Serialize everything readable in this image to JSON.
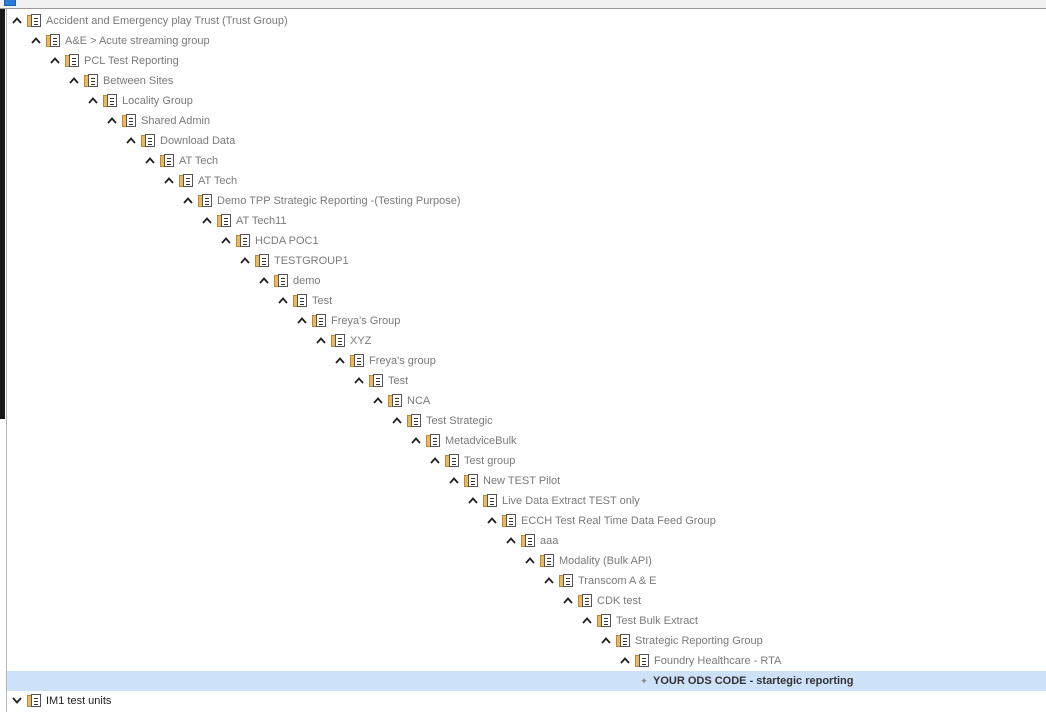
{
  "window": {
    "title": ""
  },
  "tree": {
    "nodes": [
      {
        "label": "Accident and Emergency play Trust (Trust Group)",
        "depth": 0,
        "expanded": true
      },
      {
        "label": "A&E > Acute streaming group",
        "depth": 1,
        "expanded": true
      },
      {
        "label": "PCL Test Reporting",
        "depth": 2,
        "expanded": true
      },
      {
        "label": "Between Sites",
        "depth": 3,
        "expanded": true
      },
      {
        "label": "Locality Group",
        "depth": 4,
        "expanded": true
      },
      {
        "label": "Shared Admin",
        "depth": 5,
        "expanded": true
      },
      {
        "label": "Download Data",
        "depth": 6,
        "expanded": true
      },
      {
        "label": "AT Tech",
        "depth": 7,
        "expanded": true
      },
      {
        "label": "AT Tech",
        "depth": 8,
        "expanded": true
      },
      {
        "label": "Demo TPP Strategic Reporting -(Testing Purpose)",
        "depth": 9,
        "expanded": true
      },
      {
        "label": "AT Tech11",
        "depth": 10,
        "expanded": true
      },
      {
        "label": "HCDA POC1",
        "depth": 11,
        "expanded": true
      },
      {
        "label": "TESTGROUP1",
        "depth": 12,
        "expanded": true
      },
      {
        "label": "demo",
        "depth": 13,
        "expanded": true
      },
      {
        "label": "Test",
        "depth": 14,
        "expanded": true
      },
      {
        "label": "Freya's Group",
        "depth": 15,
        "expanded": true
      },
      {
        "label": "XYZ",
        "depth": 16,
        "expanded": true
      },
      {
        "label": "Freya's group",
        "depth": 17,
        "expanded": true
      },
      {
        "label": "Test",
        "depth": 18,
        "expanded": true
      },
      {
        "label": "NCA",
        "depth": 19,
        "expanded": true
      },
      {
        "label": "Test Strategic",
        "depth": 20,
        "expanded": true
      },
      {
        "label": "MetadviceBulk",
        "depth": 21,
        "expanded": true
      },
      {
        "label": "Test group",
        "depth": 22,
        "expanded": true
      },
      {
        "label": "New TEST Pilot",
        "depth": 23,
        "expanded": true
      },
      {
        "label": "Live Data Extract TEST only",
        "depth": 24,
        "expanded": true
      },
      {
        "label": "ECCH Test Real Time Data Feed Group",
        "depth": 25,
        "expanded": true
      },
      {
        "label": "aaa",
        "depth": 26,
        "expanded": true
      },
      {
        "label": "Modality (Bulk API)",
        "depth": 27,
        "expanded": true
      },
      {
        "label": "Transcom A & E",
        "depth": 28,
        "expanded": true
      },
      {
        "label": "CDK test",
        "depth": 29,
        "expanded": true
      },
      {
        "label": "Test Bulk Extract",
        "depth": 30,
        "expanded": true
      },
      {
        "label": "Strategic Reporting Group",
        "depth": 31,
        "expanded": true
      },
      {
        "label": "Foundry Healthcare - RTA",
        "depth": 32,
        "expanded": true
      }
    ],
    "selected_leaf": {
      "label": "YOUR ODS CODE - startegic reporting",
      "depth": 33
    },
    "collapsed_root": {
      "label": "IM1 test units",
      "depth": 0,
      "expanded": false
    }
  },
  "colors": {
    "selection": "#cde1f8",
    "folder": "#e9b95f",
    "text": "#7a7a7a"
  }
}
